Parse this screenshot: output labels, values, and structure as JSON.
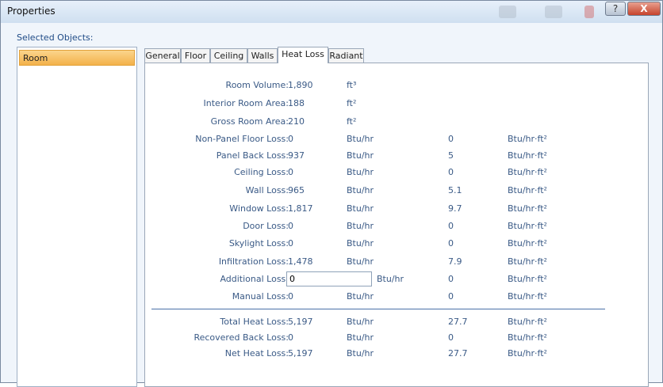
{
  "window": {
    "title": "Properties",
    "help_label": "?",
    "close_label": "X"
  },
  "selected_objects": {
    "label": "Selected Objects:",
    "items": [
      "Room"
    ]
  },
  "tabs": [
    "General",
    "Floor",
    "Ceiling",
    "Walls",
    "Heat Loss",
    "Radiant"
  ],
  "active_tab": "Heat Loss",
  "rows": [
    {
      "label": "Room Volume:",
      "value": "1,890",
      "unit": "ft³",
      "value2": "",
      "unit2": ""
    },
    {
      "label": "Interior Room Area:",
      "value": "188",
      "unit": "ft²",
      "value2": "",
      "unit2": ""
    },
    {
      "label": "Gross Room Area:",
      "value": "210",
      "unit": "ft²",
      "value2": "",
      "unit2": ""
    },
    {
      "label": "Non-Panel Floor Loss:",
      "value": "0",
      "unit": "Btu/hr",
      "value2": "0",
      "unit2": "Btu/hr·ft²"
    },
    {
      "label": "Panel Back Loss:",
      "value": "937",
      "unit": "Btu/hr",
      "value2": "5",
      "unit2": "Btu/hr·ft²"
    },
    {
      "label": "Ceiling Loss:",
      "value": "0",
      "unit": "Btu/hr",
      "value2": "0",
      "unit2": "Btu/hr·ft²"
    },
    {
      "label": "Wall Loss:",
      "value": "965",
      "unit": "Btu/hr",
      "value2": "5.1",
      "unit2": "Btu/hr·ft²"
    },
    {
      "label": "Window Loss:",
      "value": "1,817",
      "unit": "Btu/hr",
      "value2": "9.7",
      "unit2": "Btu/hr·ft²"
    },
    {
      "label": "Door Loss:",
      "value": "0",
      "unit": "Btu/hr",
      "value2": "0",
      "unit2": "Btu/hr·ft²"
    },
    {
      "label": "Skylight Loss:",
      "value": "0",
      "unit": "Btu/hr",
      "value2": "0",
      "unit2": "Btu/hr·ft²"
    },
    {
      "label": "Infiltration Loss:",
      "value": "1,478",
      "unit": "Btu/hr",
      "value2": "7.9",
      "unit2": "Btu/hr·ft²"
    },
    {
      "label": "Additional Loss:",
      "input_value": "0",
      "unit": "Btu/hr",
      "value2": "0",
      "unit2": "Btu/hr·ft²"
    },
    {
      "label": "Manual Loss:",
      "value": "0",
      "unit": "Btu/hr",
      "value2": "0",
      "unit2": "Btu/hr·ft²"
    }
  ],
  "totals": [
    {
      "label": "Total Heat Loss:",
      "value": "5,197",
      "unit": "Btu/hr",
      "value2": "27.7",
      "unit2": "Btu/hr·ft²"
    },
    {
      "label": "Recovered Back Loss:",
      "value": "0",
      "unit": "Btu/hr",
      "value2": "0",
      "unit2": "Btu/hr·ft²"
    },
    {
      "label": "Net Heat Loss:",
      "value": "5,197",
      "unit": "Btu/hr",
      "value2": "27.7",
      "unit2": "Btu/hr·ft²"
    }
  ],
  "colors": {
    "label_text": "#3a5a86",
    "selection": "#f3b14a",
    "separator": "#4a70a8"
  }
}
